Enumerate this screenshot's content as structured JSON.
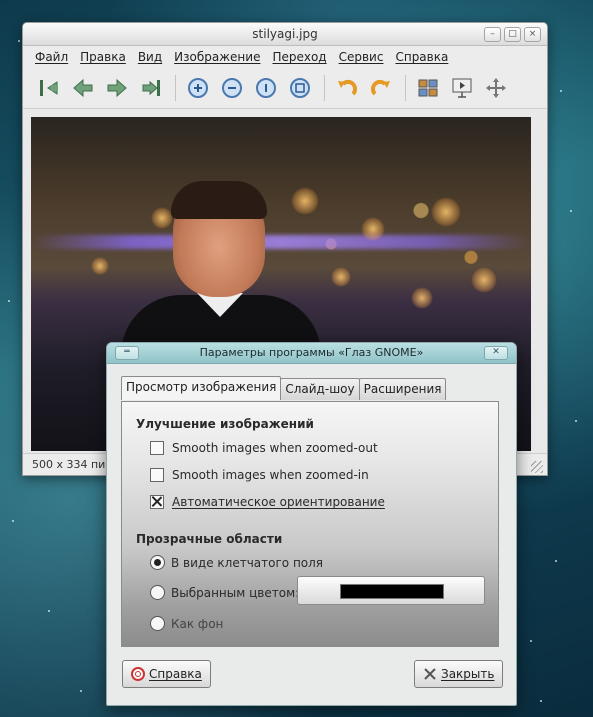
{
  "window": {
    "title": "stilyagi.jpg",
    "controls": {
      "minimize": "–",
      "maximize": "□",
      "close": "×"
    }
  },
  "menubar": {
    "items": [
      "Файл",
      "Правка",
      "Вид",
      "Изображение",
      "Переход",
      "Сервис",
      "Справка"
    ]
  },
  "toolbar": {
    "icons": [
      "go-first-icon",
      "go-previous-icon",
      "go-next-icon",
      "go-last-icon",
      "zoom-in-icon",
      "zoom-out-icon",
      "zoom-normal-icon",
      "zoom-fit-icon",
      "rotate-left-icon",
      "rotate-right-icon",
      "image-gallery-icon",
      "slideshow-icon",
      "fullscreen-icon"
    ]
  },
  "statusbar": {
    "text": "500 x 334 пикс"
  },
  "dialog": {
    "title": "Параметры программы «Глаз GNOME»",
    "tabs": [
      "Просмотр изображения",
      "Слайд-шоу",
      "Расширения"
    ],
    "active_tab": 0,
    "enhancement": {
      "heading": "Улучшение изображений",
      "options": [
        {
          "label": "Smooth images when zoomed-out",
          "checked": false
        },
        {
          "label": "Smooth images when zoomed-in",
          "checked": false
        },
        {
          "label": "Автоматическое ориентирование",
          "checked": true
        }
      ]
    },
    "transparency": {
      "heading": "Прозрачные области",
      "options": [
        {
          "label": "В виде клетчатого поля",
          "selected": true
        },
        {
          "label": "Выбранным цветом:",
          "selected": false
        },
        {
          "label": "Как фон",
          "selected": false
        }
      ],
      "color": "#000000"
    },
    "help_button": "Справка",
    "close_button": "Закрыть"
  }
}
